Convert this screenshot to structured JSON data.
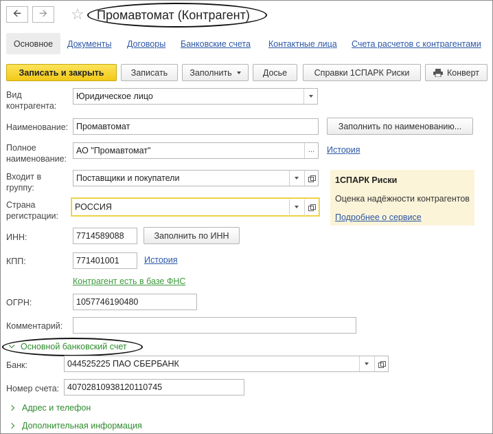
{
  "header": {
    "title": "Промавтомат (Контрагент)",
    "back_icon": "arrow-left-icon",
    "forward_icon": "arrow-right-icon",
    "favorite_icon": "star-icon"
  },
  "tabs": [
    {
      "label": "Основное",
      "active": true
    },
    {
      "label": "Документы"
    },
    {
      "label": "Договоры"
    },
    {
      "label": "Банковские счета"
    },
    {
      "label": "Контактные лица"
    },
    {
      "label": "Счета расчетов с контрагентами"
    }
  ],
  "toolbar": {
    "save_close": "Записать и закрыть",
    "save": "Записать",
    "fill": "Заполнить",
    "dossier": "Досье",
    "spark_reports": "Справки 1СПАРК Риски",
    "envelope": "Конверт"
  },
  "form": {
    "kind_label": "Вид контрагента:",
    "kind_value": "Юридическое лицо",
    "name_label": "Наименование:",
    "name_value": "Промавтомат",
    "fill_by_name": "Заполнить по наименованию...",
    "fullname_label": "Полное наименование:",
    "fullname_value": "АО \"Промавтомат\"",
    "fullname_history": "История",
    "group_label": "Входит в группу:",
    "group_value": "Поставщики и покупатели",
    "country_label": "Страна регистрации:",
    "country_value": "РОССИЯ",
    "inn_label": "ИНН:",
    "inn_value": "7714589088",
    "fill_by_inn": "Заполнить по ИНН",
    "kpp_label": "КПП:",
    "kpp_value": "771401001",
    "kpp_history": "История",
    "fns_link": "Контрагент есть в базе ФНС",
    "ogrn_label": "ОГРН:",
    "ogrn_value": "1057746190480",
    "comment_label": "Комментарий:",
    "comment_value": ""
  },
  "spark": {
    "title": "1СПАРК Риски",
    "subtitle": "Оценка надёжности контрагентов",
    "link": "Подробнее о сервисе"
  },
  "bank_section": {
    "title": "Основной банковский счет",
    "bank_label": "Банк:",
    "bank_value": "044525225 ПАО СБЕРБАНК",
    "account_label": "Номер счета:",
    "account_value": "40702810938120110745"
  },
  "collapsed_sections": {
    "address": "Адрес и телефон",
    "extra": "Дополнительная информация"
  },
  "colors": {
    "primary_button": "#f2c918",
    "link": "#2c57a6",
    "section_green": "#2e8b2e",
    "spark_panel": "#fbf4d9"
  }
}
